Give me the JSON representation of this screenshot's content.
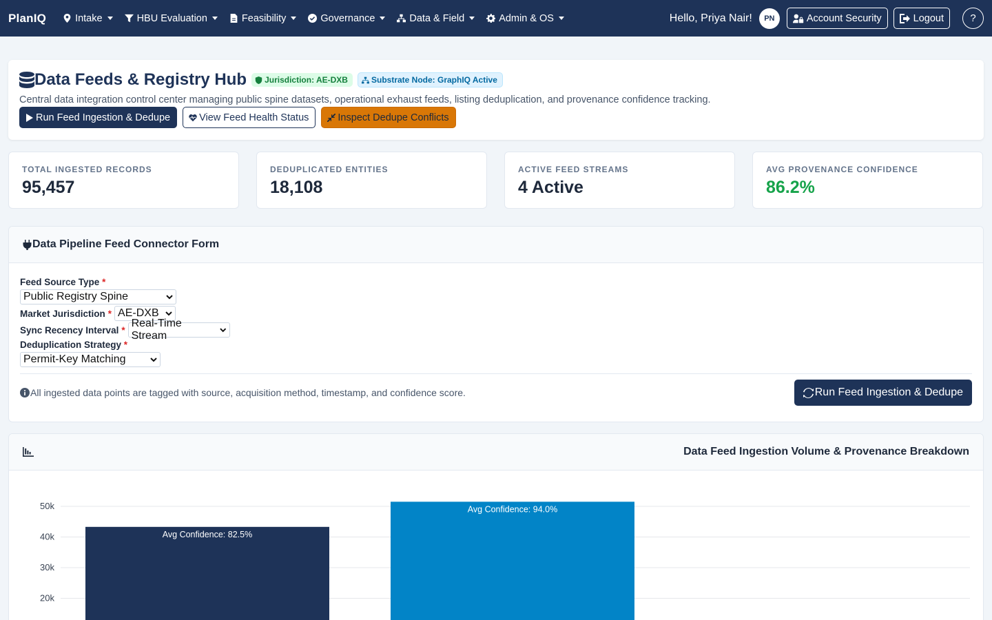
{
  "nav": {
    "brand": "PlanIQ",
    "items": [
      {
        "label": "Intake",
        "icon": "map-marker-icon"
      },
      {
        "label": "HBU Evaluation",
        "icon": "filter-icon"
      },
      {
        "label": "Feasibility",
        "icon": "file-icon"
      },
      {
        "label": "Governance",
        "icon": "check-circle-icon"
      },
      {
        "label": "Data & Field",
        "icon": "sitemap-icon"
      },
      {
        "label": "Admin & OS",
        "icon": "gear-icon"
      }
    ],
    "greeting": "Hello, Priya Nair!",
    "avatar_initials": "PN",
    "account_security_label": "Account Security",
    "logout_label": "Logout",
    "help_label": "?"
  },
  "hero": {
    "title": "Data Feeds & Registry Hub",
    "badge_jurisdiction": "Jurisdiction: AE-DXB",
    "badge_substrate": "Substrate Node: GraphIQ Active",
    "description": "Central data integration control center managing public spine datasets, operational exhaust feeds, listing deduplication, and provenance confidence tracking.",
    "btn_run": "Run Feed Ingestion & Dedupe",
    "btn_health": "View Feed Health Status",
    "btn_inspect": "Inspect Dedupe Conflicts"
  },
  "stats": [
    {
      "label": "Total Ingested Records",
      "value": "95,457"
    },
    {
      "label": "Deduplicated Entities",
      "value": "18,108"
    },
    {
      "label": "Active Feed Streams",
      "value": "4 Active"
    },
    {
      "label": "Avg Provenance Confidence",
      "value": "86.2%"
    }
  ],
  "form": {
    "title": "Data Pipeline Feed Connector Form",
    "feed_source_label": "Feed Source Type",
    "feed_source_value": "Public Registry Spine",
    "jurisdiction_label": "Market Jurisdiction",
    "jurisdiction_value": "AE-DXB",
    "sync_label": "Sync Recency Interval",
    "sync_value": "Real-Time Stream",
    "dedupe_label": "Deduplication Strategy",
    "dedupe_value": "Permit-Key Matching",
    "required_mark": "*",
    "note": "All ingested data points are tagged with source, acquisition method, timestamp, and confidence score.",
    "submit_label": "Run Feed Ingestion & Dedupe"
  },
  "chart_title": "Data Feed Ingestion Volume & Provenance Breakdown",
  "chart_data": {
    "type": "bar",
    "title": "Data Feed Ingestion Volume & Provenance Breakdown",
    "y_ticks": [
      "20k",
      "30k",
      "40k",
      "50k"
    ],
    "ylim": [
      15000,
      51500
    ],
    "grid": true,
    "bars": [
      {
        "value": 43300,
        "label": "Avg Confidence: 82.5%",
        "color": "#1e3358"
      },
      {
        "value": 51500,
        "label": "Avg Confidence: 94.0%",
        "color": "#0284c7"
      }
    ]
  }
}
